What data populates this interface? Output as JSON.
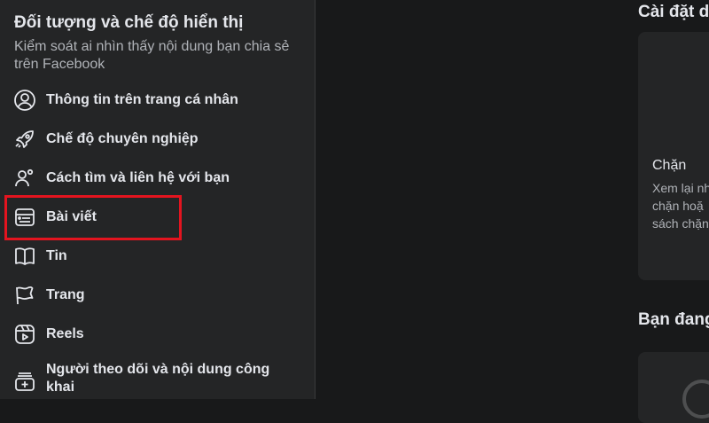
{
  "section": {
    "title": "Đối tượng và chế độ hiển thị",
    "description": "Kiểm soát ai nhìn thấy nội dung bạn chia sẻ trên Facebook"
  },
  "menu": [
    {
      "label": "Thông tin trên trang cá nhân",
      "icon": "profile-icon"
    },
    {
      "label": "Chế độ chuyên nghiệp",
      "icon": "rocket-icon"
    },
    {
      "label": "Cách tìm và liên hệ với bạn",
      "icon": "people-search-icon"
    },
    {
      "label": "Bài viết",
      "icon": "post-icon",
      "highlighted": true
    },
    {
      "label": "Tin",
      "icon": "story-book-icon"
    },
    {
      "label": "Trang",
      "icon": "flag-icon"
    },
    {
      "label": "Reels",
      "icon": "reels-icon"
    },
    {
      "label": "Người theo dõi và nội dung công khai",
      "icon": "followers-icon"
    }
  ],
  "right": {
    "settings_title": "Cài đặt d",
    "card": {
      "title": "Chặn",
      "desc_line1": "Xem lại nh",
      "desc_line2": "chặn hoặ",
      "desc_line3": "sách chặn"
    },
    "bottom_title": "Bạn đang"
  },
  "colors": {
    "highlight_border": "#e3141f",
    "sidebar_bg": "#242526",
    "page_bg": "#18191a"
  }
}
